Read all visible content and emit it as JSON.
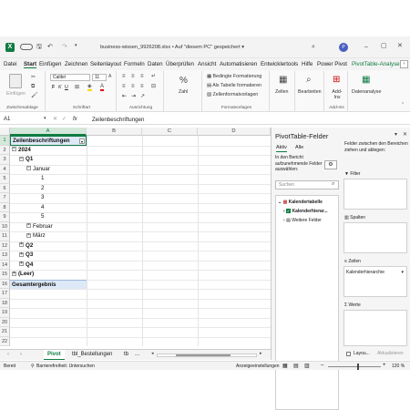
{
  "titlebar": {
    "autosave": "⏱",
    "filename": "business-wissen_9926208.xlsx",
    "saved_status": "Auf \"diesem PC\" gespeichert",
    "user_initial": "P"
  },
  "tabs": [
    "Datei",
    "Start",
    "Einfügen",
    "Zeichnen",
    "Seitenlayout",
    "Formeln",
    "Daten",
    "Überprüfen",
    "Ansicht",
    "Automatisieren",
    "Entwicklertools",
    "Hilfe",
    "Power Pivot",
    "PivotTable-Analyse"
  ],
  "ribbon": {
    "paste": "Einfügen",
    "clipboard": "Zwischenablage",
    "font_name": "Calibri",
    "font_size": "11",
    "font_group": "Schriftart",
    "align_group": "Ausrichtung",
    "number_label": "Zahl",
    "cond_format": "Bedingte Formatierung",
    "as_table": "Als Tabelle formatieren",
    "cell_styles": "Zellenformatvorlagen",
    "styles_group": "Formatvorlagen",
    "cells": "Zellen",
    "editing": "Bearbeiten",
    "addins": "Add-Ins",
    "addins_group": "Add-Ins",
    "data_analysis": "Datenanalyse"
  },
  "formula_bar": {
    "name_box": "A1",
    "fx": "fx",
    "value": "Zeilenbeschriftungen"
  },
  "grid": {
    "columns": [
      "A",
      "B",
      "C",
      "D"
    ],
    "rows": [
      "1",
      "2",
      "3",
      "4",
      "5",
      "6",
      "7",
      "8",
      "9",
      "10",
      "11",
      "12",
      "13",
      "14",
      "15",
      "16",
      "17",
      "18",
      "19",
      "20",
      "21",
      "22"
    ],
    "header_cell": "Zeilenbeschriftungen",
    "entries": [
      {
        "text": "2024",
        "level": 0,
        "toggle": "−",
        "bold": true
      },
      {
        "text": "Q1",
        "level": 1,
        "toggle": "−",
        "bold": true
      },
      {
        "text": "Januar",
        "level": 2,
        "toggle": "−",
        "bold": false
      },
      {
        "text": "1",
        "level": 3,
        "toggle": "",
        "bold": false
      },
      {
        "text": "2",
        "level": 3,
        "toggle": "",
        "bold": false
      },
      {
        "text": "3",
        "level": 3,
        "toggle": "",
        "bold": false
      },
      {
        "text": "4",
        "level": 3,
        "toggle": "",
        "bold": false
      },
      {
        "text": "5",
        "level": 3,
        "toggle": "",
        "bold": false
      },
      {
        "text": "Februar",
        "level": 2,
        "toggle": "+",
        "bold": false
      },
      {
        "text": "März",
        "level": 2,
        "toggle": "+",
        "bold": false
      },
      {
        "text": "Q2",
        "level": 1,
        "toggle": "+",
        "bold": true
      },
      {
        "text": "Q3",
        "level": 1,
        "toggle": "+",
        "bold": true
      },
      {
        "text": "Q4",
        "level": 1,
        "toggle": "+",
        "bold": true
      },
      {
        "text": "(Leer)",
        "level": 0,
        "toggle": "+",
        "bold": true
      },
      {
        "text": "Gesamtergebnis",
        "level": 0,
        "toggle": "",
        "bold": true
      }
    ]
  },
  "pane": {
    "title": "PivotTable-Felder",
    "tab_active": "Aktiv",
    "tab_all": "Alle",
    "choose_fields": "In den Bericht aufzunehmende Felder auswählen:",
    "search_placeholder": "Suchen",
    "table_name": "Kalendertabelle",
    "field_hierarchy": "Kalenderhierar...",
    "more_fields": "Weitere Felder",
    "drag_hint": "Felder zwischen den Bereichen ziehen und ablegen:",
    "filter": "Filter",
    "columns": "Spalten",
    "rows": "Zeilen",
    "rows_item": "Kalenderhierarchie",
    "values": "Werte",
    "defer_layout": "Layou...",
    "update_button": "Aktualisieren"
  },
  "sheets": {
    "active": "Pivot",
    "second": "tbl_Bestellungen",
    "third": "tb",
    "more": "..."
  },
  "status": {
    "ready": "Bereit",
    "accessibility": "Barrierefreiheit: Untersuchen",
    "display_settings": "Anzeigeeinstellungen",
    "zoom": "120 %"
  },
  "colors": {
    "accent_green": "#217346",
    "pivot_tab_green": "#107c41"
  }
}
